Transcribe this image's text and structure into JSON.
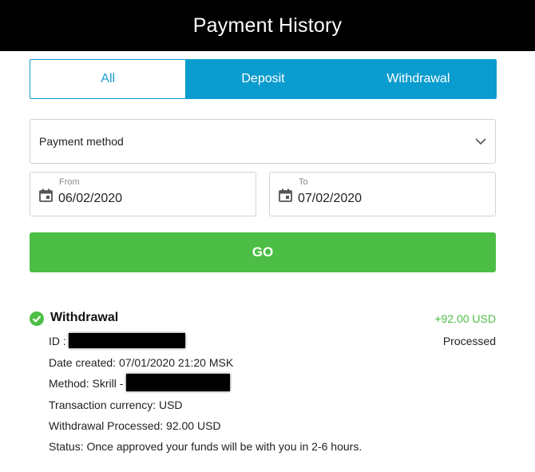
{
  "header": {
    "title": "Payment History"
  },
  "tabs": [
    {
      "label": "All",
      "active": true
    },
    {
      "label": "Deposit",
      "active": false
    },
    {
      "label": "Withdrawal",
      "active": false
    }
  ],
  "filter": {
    "payment_method_label": "Payment method",
    "from": {
      "label": "From",
      "value": "06/02/2020"
    },
    "to": {
      "label": "To",
      "value": "07/02/2020"
    },
    "go_label": "GO"
  },
  "transaction": {
    "type": "Withdrawal",
    "amount": "+92.00 USD",
    "status_badge": "Processed",
    "id_label": "ID :",
    "date_created": "Date created: 07/01/2020 21:20 MSK",
    "method_label": "Method: Skrill -",
    "currency": "Transaction currency: USD",
    "processed": "Withdrawal Processed: 92.00 USD",
    "status_text": "Status: Once approved your funds will be with you in 2-6 hours."
  },
  "colors": {
    "header_bg": "#000000",
    "tab_accent": "#0b9ccf",
    "go_button": "#4cbe46",
    "amount_positive": "#4cbe46"
  },
  "icons": {
    "select": "chevron-down-icon",
    "date": "calendar-icon",
    "status": "check-circle-icon"
  }
}
